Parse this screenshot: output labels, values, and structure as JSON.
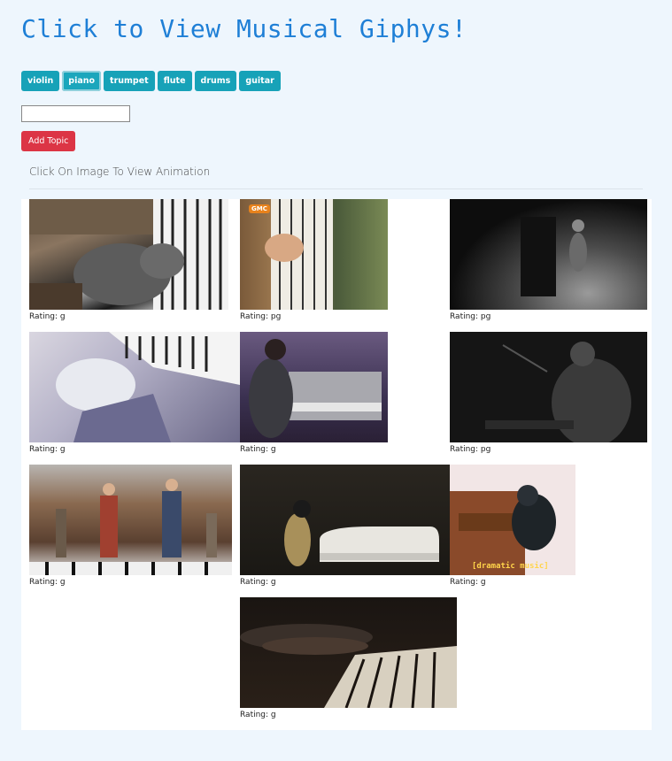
{
  "header": {
    "title": "Click to View Musical Giphys!"
  },
  "topics": [
    {
      "label": "violin",
      "active": false
    },
    {
      "label": "piano",
      "active": true
    },
    {
      "label": "trumpet",
      "active": false
    },
    {
      "label": "flute",
      "active": false
    },
    {
      "label": "drums",
      "active": false
    },
    {
      "label": "guitar",
      "active": false
    }
  ],
  "form": {
    "input_value": "",
    "add_label": "Add Topic"
  },
  "instructions": "Click On Image To View Animation",
  "gifs": [
    {
      "rating": "Rating: g",
      "subject": "gray-cat-playing-piano"
    },
    {
      "rating": "Rating: pg",
      "subject": "hands-on-keys-closeup",
      "badge": "GMC"
    },
    {
      "rating": "Rating: pg",
      "subject": "pianist-dark-stage"
    },
    {
      "rating": "Rating: g",
      "subject": "anime-character-playing-piano"
    },
    {
      "rating": "Rating: g",
      "subject": "man-at-grand-piano"
    },
    {
      "rating": "Rating: pg",
      "subject": "pianist-singing-dark"
    },
    {
      "rating": "Rating: g",
      "subject": "floor-piano-dance-scene"
    },
    {
      "rating": "Rating: g",
      "subject": "pianist-white-grand-piano"
    },
    {
      "rating": "Rating: g",
      "subject": "ape-dramatic-piano",
      "caption": "[dramatic music]"
    },
    {
      "rating": "Rating: g",
      "subject": "hands-on-piano-dark"
    }
  ]
}
